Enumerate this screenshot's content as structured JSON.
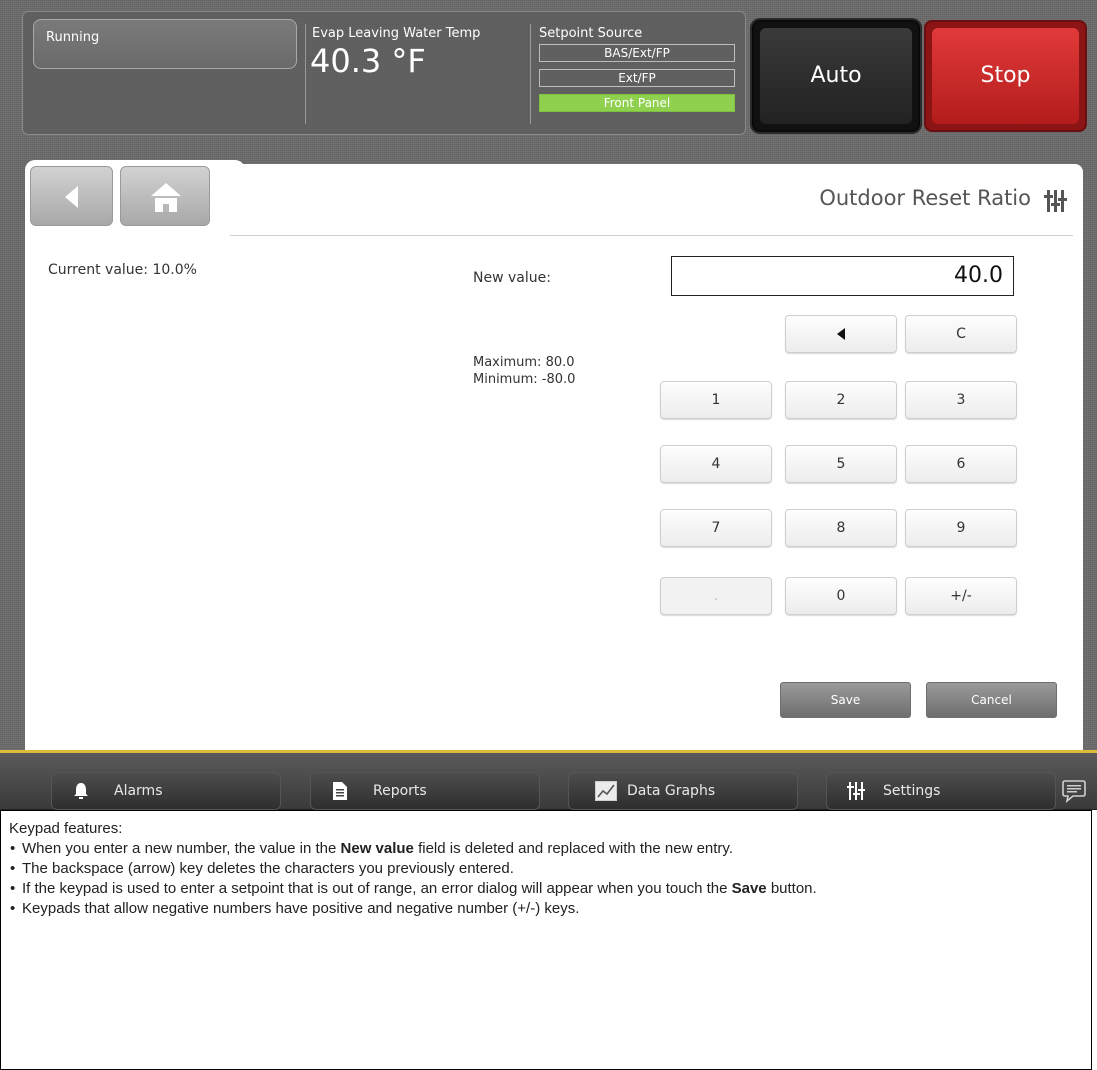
{
  "status": {
    "operating_mode": "Running",
    "evap_label": "Evap Leaving Water Temp",
    "evap_value": "40.3 °F",
    "setpoint_source_label": "Setpoint Source",
    "setpoint_sources": [
      "BAS/Ext/FP",
      "Ext/FP",
      "Front Panel"
    ],
    "active_source": "Front Panel"
  },
  "controls": {
    "auto_label": "Auto",
    "stop_label": "Stop"
  },
  "header": {
    "title": "Outdoor Reset Ratio"
  },
  "editor": {
    "current_value": "Current value: 10.0%",
    "new_value_label": "New value:",
    "new_value": "40.0",
    "maximum": "Maximum: 80.0",
    "minimum": "Minimum: -80.0"
  },
  "keypad": {
    "backspace": "◀",
    "clear": "C",
    "digits": [
      "1",
      "2",
      "3",
      "4",
      "5",
      "6",
      "7",
      "8",
      "9",
      "0"
    ],
    "decimal": ".",
    "sign": "+/-"
  },
  "actions": {
    "save": "Save",
    "cancel": "Cancel"
  },
  "bottom_nav": {
    "alarms": "Alarms",
    "reports": "Reports",
    "data_graphs": "Data Graphs",
    "settings": "Settings"
  },
  "doc": {
    "heading": "Keypad features:",
    "item1_a": "When you enter a new number, the value in the ",
    "item1_b": "New value",
    "item1_c": " field is deleted and replaced with the new entry.",
    "item2": "The backspace (arrow) key deletes the characters you previously entered.",
    "item3_a": "If the keypad is used to enter a setpoint that is out of range, an error dialog will appear when you touch the ",
    "item3_b": "Save",
    "item3_c": " button.",
    "item4": "Keypads that allow negative numbers have positive and negative number (+/-) keys."
  },
  "colors": {
    "active_source": "#8fd14f",
    "stop_red": "#c62828",
    "auto_black": "#1a1a1a",
    "accent_line": "#e0b83a"
  }
}
